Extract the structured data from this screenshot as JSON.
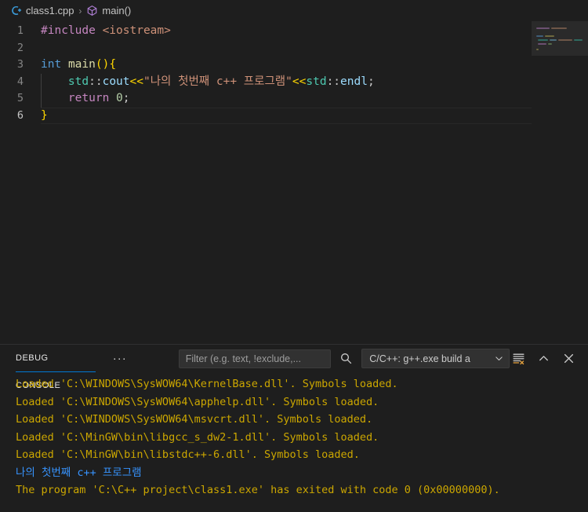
{
  "breadcrumb": {
    "file_icon": "cpp-file-icon",
    "file": "class1.cpp",
    "separator": "›",
    "symbol_icon": "symbol-method-cube-icon",
    "symbol": "main()"
  },
  "editor": {
    "lines": [
      {
        "number": "1",
        "tokens": [
          {
            "text": "#include",
            "cls": "t-pre"
          },
          {
            "text": " ",
            "cls": "t-punct"
          },
          {
            "text": "<iostream>",
            "cls": "t-inc"
          }
        ]
      },
      {
        "number": "2",
        "tokens": []
      },
      {
        "number": "3",
        "tokens": [
          {
            "text": "int",
            "cls": "t-kw"
          },
          {
            "text": " ",
            "cls": "t-punct"
          },
          {
            "text": "main",
            "cls": "t-fn"
          },
          {
            "text": "()",
            "cls": "t-br1"
          },
          {
            "text": "{",
            "cls": "t-br1"
          }
        ]
      },
      {
        "number": "4",
        "tokens": [
          {
            "text": "    ",
            "cls": "t-punct"
          },
          {
            "text": "std",
            "cls": "t-ns"
          },
          {
            "text": "::",
            "cls": "t-punct"
          },
          {
            "text": "cout",
            "cls": "t-var"
          },
          {
            "text": "<<",
            "cls": "t-br1"
          },
          {
            "text": "\"나의 첫번째 c++ 프로그램\"",
            "cls": "t-str"
          },
          {
            "text": "<<",
            "cls": "t-br1"
          },
          {
            "text": "std",
            "cls": "t-ns"
          },
          {
            "text": "::",
            "cls": "t-punct"
          },
          {
            "text": "endl",
            "cls": "t-var"
          },
          {
            "text": ";",
            "cls": "t-punct"
          }
        ]
      },
      {
        "number": "5",
        "tokens": [
          {
            "text": "    ",
            "cls": "t-punct"
          },
          {
            "text": "return",
            "cls": "t-pre"
          },
          {
            "text": " ",
            "cls": "t-punct"
          },
          {
            "text": "0",
            "cls": "t-num"
          },
          {
            "text": ";",
            "cls": "t-punct"
          }
        ]
      },
      {
        "number": "6",
        "tokens": [
          {
            "text": "}",
            "cls": "t-br1"
          }
        ]
      }
    ],
    "current_line": "6",
    "minimap_name": "minimap"
  },
  "panel": {
    "tab_label": "DEBUG CONSOLE",
    "more_label": "···",
    "filter": {
      "value": "",
      "placeholder": "Filter (e.g. text, !exclude,..."
    },
    "search_icon": "search-icon",
    "session": {
      "label": "C/C++: g++.exe build a",
      "chevron_icon": "chevron-down-icon"
    },
    "actions": {
      "clear_icon": "clear-console-icon",
      "maximize_icon": "chevron-up-icon",
      "close_icon": "close-icon"
    },
    "console_lines": [
      {
        "text": "Loaded 'C:\\WINDOWS\\SysWOW64\\KernelBase.dll'. Symbols loaded.",
        "cls": "c-warn"
      },
      {
        "text": "Loaded 'C:\\WINDOWS\\SysWOW64\\apphelp.dll'. Symbols loaded.",
        "cls": "c-warn"
      },
      {
        "text": "Loaded 'C:\\WINDOWS\\SysWOW64\\msvcrt.dll'. Symbols loaded.",
        "cls": "c-warn"
      },
      {
        "text": "Loaded 'C:\\MinGW\\bin\\libgcc_s_dw2-1.dll'. Symbols loaded.",
        "cls": "c-warn"
      },
      {
        "text": "Loaded 'C:\\MinGW\\bin\\libstdc++-6.dll'. Symbols loaded.",
        "cls": "c-warn"
      },
      {
        "text": "나의 첫번째 c++ 프로그램",
        "cls": "c-info"
      },
      {
        "text": "The program 'C:\\C++ project\\class1.exe' has exited with code 0 (0x00000000).",
        "cls": "c-warn"
      }
    ]
  },
  "colors": {
    "editor_background": "#1e1e1e",
    "accent": "#0078d4",
    "console_warn": "#cca700",
    "console_info": "#3794ff",
    "line_number": "#858585"
  }
}
